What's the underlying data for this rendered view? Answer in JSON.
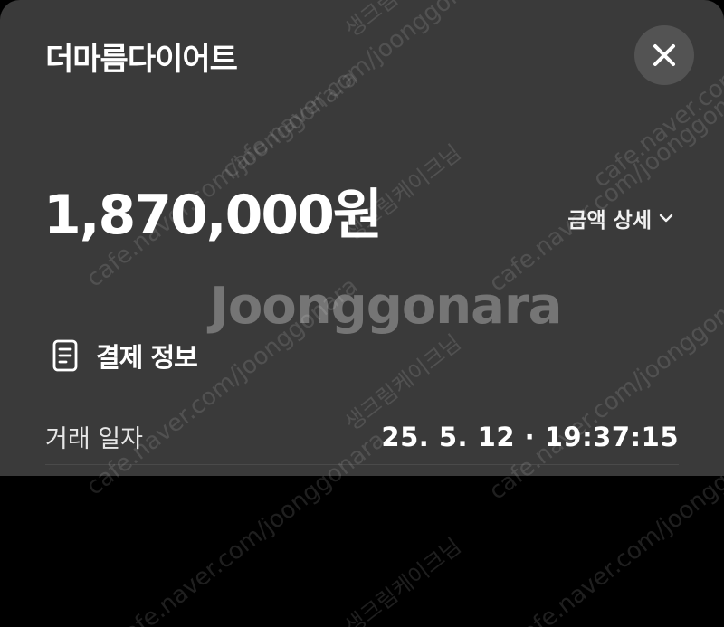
{
  "sheet": {
    "merchant_name": "더마름다이어트",
    "amount": "1,870,000원",
    "amount_detail_label": "금액 상세"
  },
  "payment_info": {
    "title": "결제 정보",
    "rows": [
      {
        "label": "거래 일자",
        "value": "25. 5. 12 · 19:37:15"
      }
    ]
  },
  "watermark": {
    "brand": "Joonggonara",
    "url": "cafe.naver.com/joonggonara",
    "seller": "생크림케이크님"
  },
  "colors": {
    "sheet_bg": "#3a3a3a",
    "page_bg": "#000000",
    "close_button_bg": "#535353"
  },
  "icons": {
    "close": "close-icon",
    "amount_detail": "chevron-down-icon",
    "payment_info": "receipt-icon"
  }
}
